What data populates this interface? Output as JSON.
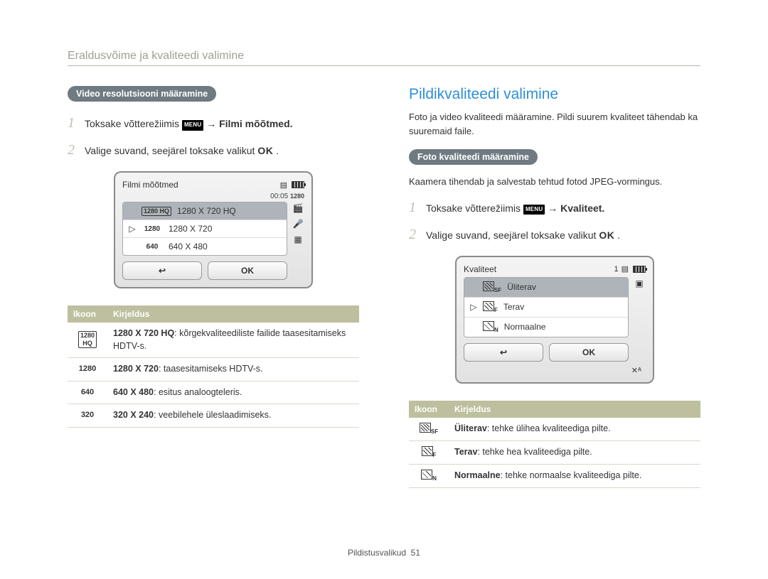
{
  "page_title": "Eraldusvõime ja kvaliteedi valimine",
  "left": {
    "pill": "Video resolutsiooni määramine",
    "step1_pre": "Toksake võtterežiimis ",
    "step1_menu": "MENU",
    "step1_post": " → Filmi mõõtmed.",
    "step2_pre": "Valige suvand, seejärel toksake valikut ",
    "step2_ok": "OK",
    "step2_post": " .",
    "lcd": {
      "title": "Filmi mõõtmed",
      "time": "00:05",
      "time_tag": "1280",
      "rows": [
        {
          "icon": "1280 HQ",
          "label": "1280 X 720 HQ"
        },
        {
          "icon": "1280",
          "label": "1280 X 720"
        },
        {
          "icon": "640",
          "label": "640 X 480"
        }
      ],
      "ok": "OK"
    },
    "table": {
      "h1": "Ikoon",
      "h2": "Kirjeldus",
      "rows": [
        {
          "icon": "1280\nHQ",
          "bold": "1280 X 720 HQ",
          "text": ": kõrgekvaliteediliste failide taasesitamiseks HDTV-s."
        },
        {
          "icon": "1280",
          "bold": "1280 X 720",
          "text": ": taasesitamiseks HDTV-s."
        },
        {
          "icon": "640",
          "bold": "640 X 480",
          "text": ": esitus analoogteleris."
        },
        {
          "icon": "320",
          "bold": "320 X 240",
          "text": ": veebilehele üleslaadimiseks."
        }
      ]
    }
  },
  "right": {
    "title": "Pildikvaliteedi valimine",
    "intro": "Foto ja video kvaliteedi määramine. Pildi suurem kvaliteet tähendab ka suuremaid faile.",
    "pill": "Foto kvaliteedi määramine",
    "para": "Kaamera tihendab ja salvestab tehtud fotod JPEG-vormingus.",
    "step1_pre": "Toksake võtterežiimis ",
    "step1_menu": "MENU",
    "step1_post": " → Kvaliteet.",
    "step2_pre": "Valige suvand, seejärel toksake valikut ",
    "step2_ok": "OK",
    "step2_post": " .",
    "lcd": {
      "title": "Kvaliteet",
      "counter": "1",
      "rows": [
        {
          "sub": "SF",
          "label": "Üliterav"
        },
        {
          "sub": "F",
          "label": "Terav"
        },
        {
          "sub": "N",
          "label": "Normaalne"
        }
      ],
      "ok": "OK",
      "tag": "✕ᴬ"
    },
    "table": {
      "h1": "Ikoon",
      "h2": "Kirjeldus",
      "rows": [
        {
          "sub": "SF",
          "bold": "Üliterav",
          "text": ": tehke ülihea kvaliteediga pilte."
        },
        {
          "sub": "F",
          "bold": "Terav",
          "text": ": tehke hea kvaliteediga pilte."
        },
        {
          "sub": "N",
          "bold": "Normaalne",
          "text": ": tehke normaalse kvaliteediga pilte."
        }
      ]
    }
  },
  "footer": {
    "label": "Pildistusvalikud",
    "page": "51"
  }
}
